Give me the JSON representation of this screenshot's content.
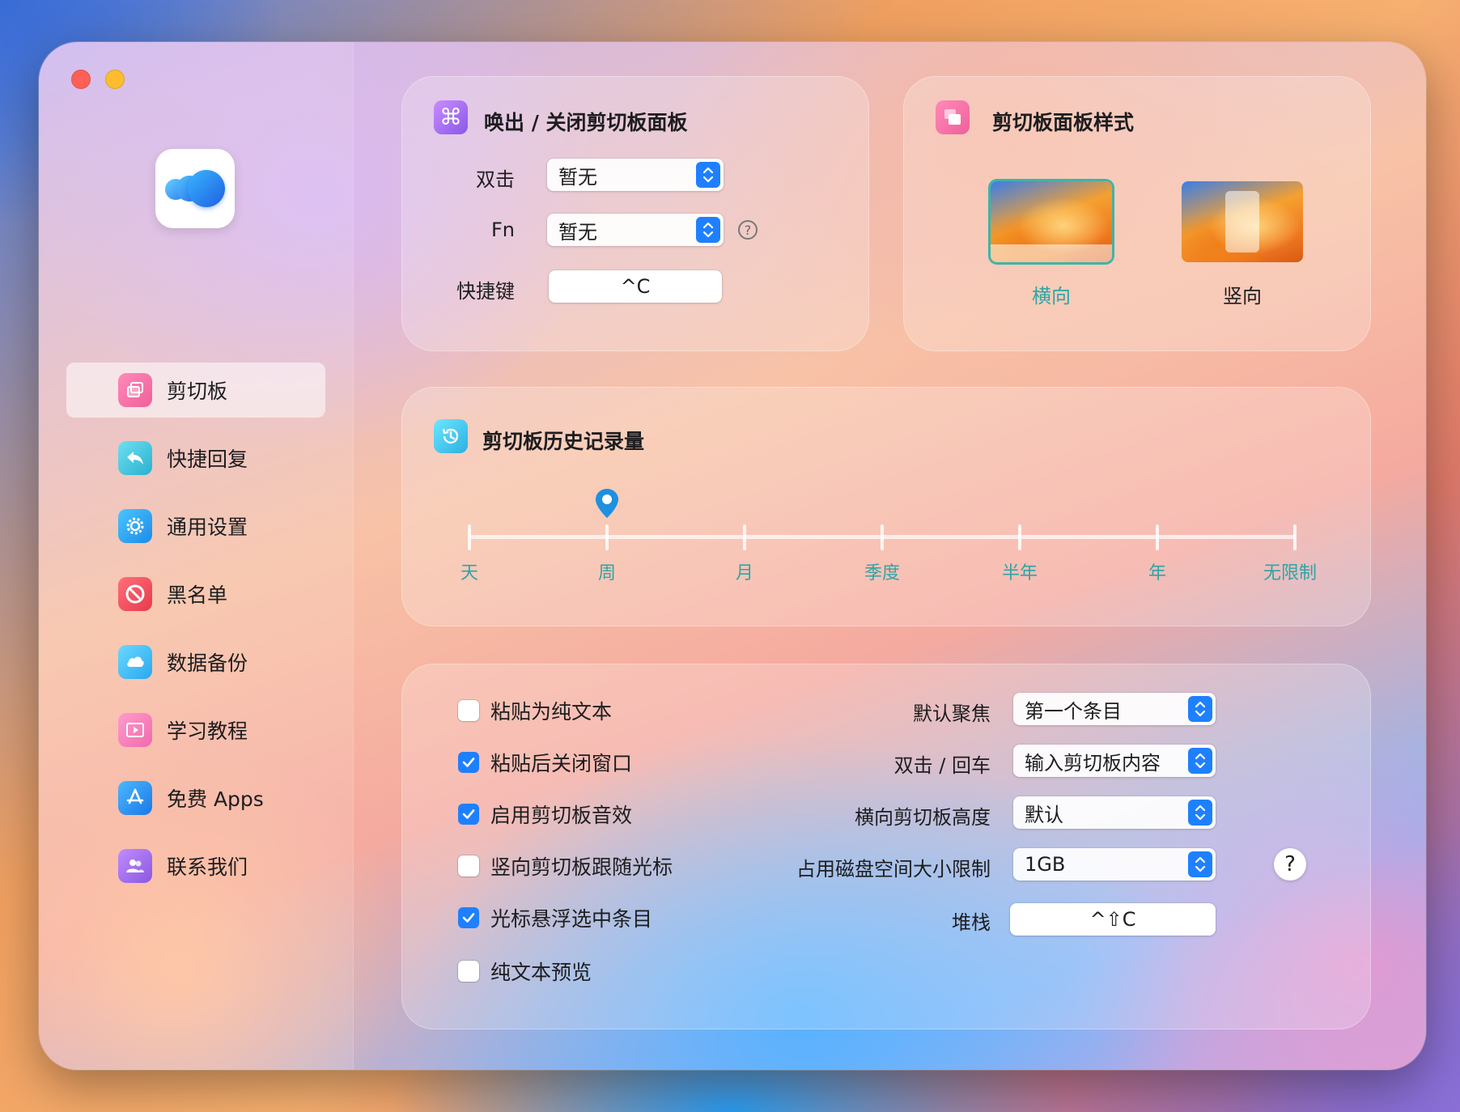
{
  "sidebar": {
    "items": [
      {
        "label": "剪切板",
        "icon": "clipboard-icon",
        "color": "#f0609a"
      },
      {
        "label": "快捷回复",
        "icon": "reply-icon",
        "color": "#3cc0d8"
      },
      {
        "label": "通用设置",
        "icon": "gear-icon",
        "color": "#1e9cf0"
      },
      {
        "label": "黑名单",
        "icon": "block-icon",
        "color": "#f04a5a"
      },
      {
        "label": "数据备份",
        "icon": "cloud-icon",
        "color": "#3cb8f0"
      },
      {
        "label": "学习教程",
        "icon": "tutorial-icon",
        "color": "#f070b0"
      },
      {
        "label": "免费 Apps",
        "icon": "appstore-icon",
        "color": "#1e88f0"
      },
      {
        "label": "联系我们",
        "icon": "contacts-icon",
        "color": "#9a64e8"
      }
    ],
    "active_index": 0
  },
  "toggle_panel": {
    "title": "唤出 / 关闭剪切板面板",
    "icon": "command-icon",
    "double_click_label": "双击",
    "double_click_value": "暂无",
    "fn_label": "Fn",
    "fn_value": "暂无",
    "shortcut_label": "快捷键",
    "shortcut_value": "^C"
  },
  "panel_style": {
    "title": "剪切板面板样式",
    "icon": "windows-icon",
    "options": [
      {
        "label": "横向",
        "selected": true
      },
      {
        "label": "竖向",
        "selected": false
      }
    ]
  },
  "history": {
    "title": "剪切板历史记录量",
    "icon": "history-icon",
    "ticks": [
      "天",
      "周",
      "月",
      "季度",
      "半年",
      "年",
      "无限制"
    ],
    "selected_index": 1
  },
  "options": {
    "checkboxes": [
      {
        "label": "粘贴为纯文本",
        "checked": false
      },
      {
        "label": "粘贴后关闭窗口",
        "checked": true
      },
      {
        "label": "启用剪切板音效",
        "checked": true
      },
      {
        "label": "竖向剪切板跟随光标",
        "checked": false
      },
      {
        "label": "光标悬浮选中条目",
        "checked": true
      },
      {
        "label": "纯文本预览",
        "checked": false
      }
    ],
    "default_focus_label": "默认聚焦",
    "default_focus_value": "第一个条目",
    "dblclick_enter_label": "双击 / 回车",
    "dblclick_enter_value": "输入剪切板内容",
    "horizontal_height_label": "横向剪切板高度",
    "horizontal_height_value": "默认",
    "disk_limit_label": "占用磁盘空间大小限制",
    "disk_limit_value": "1GB",
    "stack_label": "堆栈",
    "stack_value": "^⇧C"
  },
  "colors": {
    "accent": "#1e80ff",
    "teal_label": "#2fa4a6"
  }
}
